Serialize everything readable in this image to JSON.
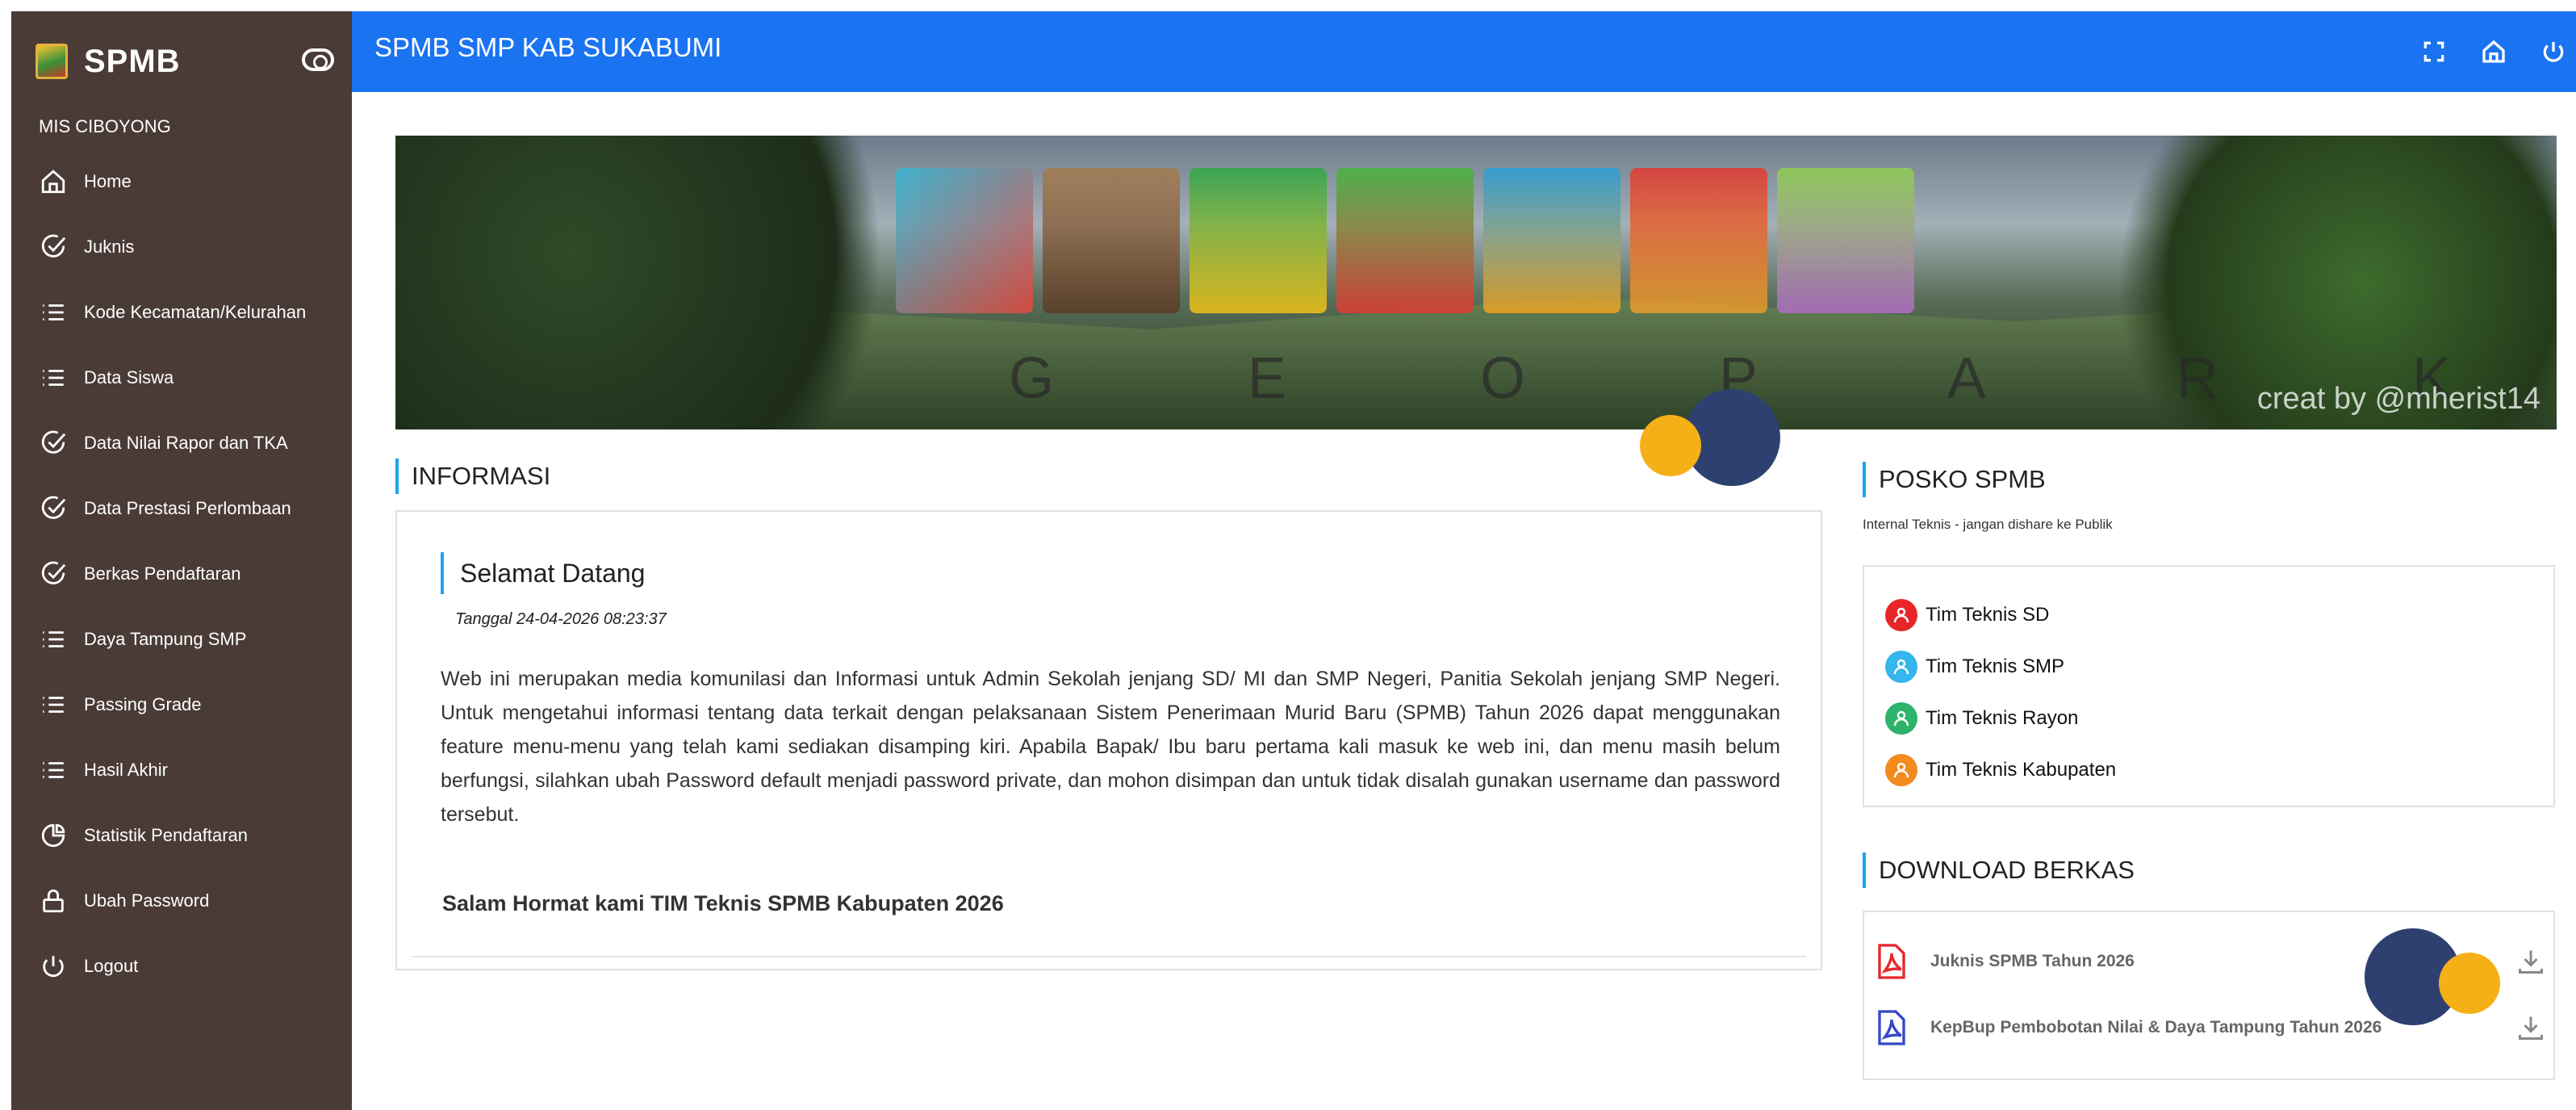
{
  "sidebar": {
    "brand": "SPMB",
    "school": "MIS CIBOYONG",
    "items": [
      {
        "label": "Home",
        "icon": "home-icon"
      },
      {
        "label": "Juknis",
        "icon": "check-circle-icon"
      },
      {
        "label": "Kode Kecamatan/Kelurahan",
        "icon": "list-icon"
      },
      {
        "label": "Data Siswa",
        "icon": "list-icon"
      },
      {
        "label": "Data Nilai Rapor dan TKA",
        "icon": "check-circle-icon"
      },
      {
        "label": "Data Prestasi Perlombaan",
        "icon": "check-circle-icon"
      },
      {
        "label": "Berkas Pendaftaran",
        "icon": "check-circle-icon"
      },
      {
        "label": "Daya Tampung SMP",
        "icon": "list-icon"
      },
      {
        "label": "Passing Grade",
        "icon": "list-icon"
      },
      {
        "label": "Hasil Akhir",
        "icon": "list-icon"
      },
      {
        "label": "Statistik Pendaftaran",
        "icon": "pie-chart-icon"
      },
      {
        "label": "Ubah Password",
        "icon": "lock-icon"
      },
      {
        "label": "Logout",
        "icon": "power-icon"
      }
    ]
  },
  "topbar": {
    "title": "SPMB SMP KAB SUKABUMI",
    "icons": [
      "fullscreen-icon",
      "home-icon",
      "power-icon"
    ]
  },
  "banner": {
    "credit": "creat by @mherist14",
    "subtitle": "G E O P A R K"
  },
  "informasi": {
    "heading": "INFORMASI",
    "card": {
      "title": "Selamat Datang",
      "date": "Tanggal 24-04-2026 08:23:37",
      "body": "Web ini merupakan media komunilasi dan Informasi untuk Admin Sekolah jenjang SD/ MI dan SMP Negeri, Panitia Sekolah jenjang SMP Negeri. Untuk mengetahui informasi tentang data terkait dengan pelaksanaan Sistem Penerimaan Murid Baru (SPMB) Tahun 2026 dapat menggunakan feature menu-menu yang telah kami sediakan disamping kiri. Apabila Bapak/ Ibu baru pertama kali masuk ke web ini, dan menu masih belum berfungsi, silahkan ubah Password default menjadi password private, dan mohon disimpan dan untuk tidak disalah gunakan username dan password tersebut.",
      "signature": "Salam Hormat kami TIM Teknis SPMB Kabupaten 2026"
    }
  },
  "posko": {
    "heading": "POSKO SPMB",
    "subtitle": "Internal Teknis - jangan dishare ke Publik",
    "teams": [
      {
        "label": "Tim Teknis SD",
        "color": "#e8262a"
      },
      {
        "label": "Tim Teknis SMP",
        "color": "#35b6ec"
      },
      {
        "label": "Tim Teknis Rayon",
        "color": "#2db36a"
      },
      {
        "label": "Tim Teknis Kabupaten",
        "color": "#f28a1e"
      }
    ]
  },
  "download": {
    "heading": "DOWNLOAD BERKAS",
    "files": [
      {
        "label": "Juknis SPMB Tahun 2026",
        "icon_color": "#e8262a"
      },
      {
        "label": "KepBup Pembobotan Nilai & Daya Tampung Tahun 2026",
        "icon_color": "#3447c8"
      }
    ]
  },
  "colors": {
    "sidebar_bg": "#4a3b36",
    "topbar_bg": "#1a73f0",
    "accent": "#1ea5ec",
    "deco_navy": "#2d4070",
    "deco_yellow": "#f5b017"
  }
}
